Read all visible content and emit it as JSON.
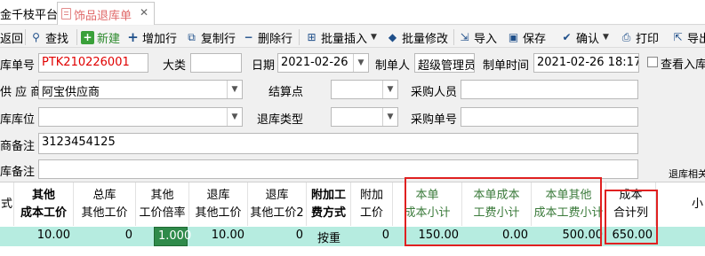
{
  "tabs": {
    "app": "金千枝平台",
    "doc": "饰品退库单"
  },
  "toolbar": {
    "back": "返回",
    "find": "查找",
    "new": "新建",
    "add_row": "增加行",
    "copy_row": "复制行",
    "del_row": "删除行",
    "batch_insert": "批量插入",
    "batch_edit": "批量修改",
    "import": "导入",
    "save": "保存",
    "confirm": "确认",
    "print": "打印",
    "export": "导出"
  },
  "form": {
    "order_no_label": "库单号",
    "order_no": "PTK210226001",
    "category_label": "大类",
    "category": "",
    "date_label": "日期",
    "date": "2021-02-26",
    "creator_label": "制单人",
    "creator": "超级管理员",
    "created_time_label": "制单时间",
    "created_time": "2021-02-26 18:17",
    "view_stock_label": "查看入库",
    "supplier_label": "供 应 商",
    "supplier": "阿宝供应商",
    "settle_label": "结算点",
    "settle": "",
    "buyer_label": "采购人员",
    "buyer": "",
    "location_label": "库库位",
    "location": "",
    "return_type_label": "退库类型",
    "return_type": "",
    "purchase_no_label": "采购单号",
    "purchase_no": "",
    "supplier_note_label": "商备注",
    "supplier_note": "3123454125",
    "stock_note_label": "库备注",
    "stock_note": "",
    "right_hint": "退库相关"
  },
  "grid": {
    "headers": [
      {
        "l1": "",
        "l2": "式"
      },
      {
        "l1": "其他",
        "l2": "成本工价"
      },
      {
        "l1": "总库",
        "l2": "其他工价"
      },
      {
        "l1": "其他",
        "l2": "工价倍率"
      },
      {
        "l1": "退库",
        "l2": "其他工价"
      },
      {
        "l1": "退库",
        "l2": "其他工价2"
      },
      {
        "l1": "附加工",
        "l2": "费方式"
      },
      {
        "l1": "附加",
        "l2": "工价"
      },
      {
        "l1": "本单",
        "l2": "成本小计"
      },
      {
        "l1": "本单成本",
        "l2": "工费小计"
      },
      {
        "l1": "本单其他",
        "l2": "成本工费小计"
      },
      {
        "l1": "成本",
        "l2": "合计列"
      },
      {
        "l1": "",
        "l2": "小"
      }
    ],
    "row": [
      "",
      "10.00",
      "0",
      "1.000",
      "10.00",
      "0",
      "按重",
      "0",
      "150.00",
      "0.00",
      "500.00",
      "650.00",
      ""
    ]
  },
  "colors": {
    "row_bg": "#b6ece0",
    "highlight": "#e02020",
    "green_header": "#3a7a3a"
  }
}
